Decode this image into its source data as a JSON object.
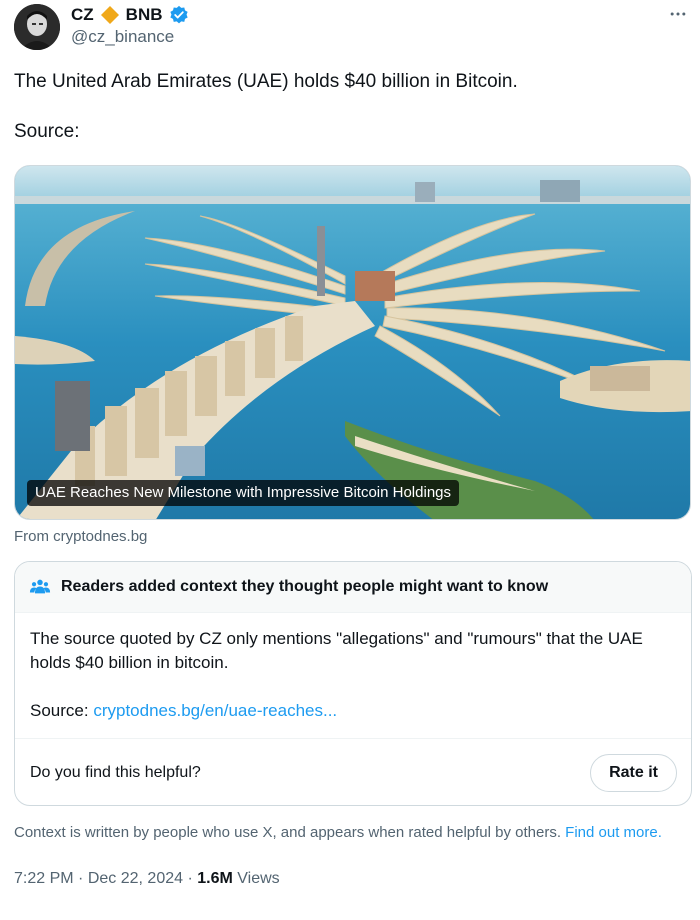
{
  "author": {
    "name": "CZ",
    "affiliation_label": "BNB",
    "handle": "@cz_binance",
    "icons": {
      "affiliation": "bnb-diamond-icon",
      "verified": "verified-badge-icon",
      "more": "more-horizontal-icon"
    },
    "colors": {
      "affiliation": "#f0a81a",
      "verified": "#1d9bf0"
    }
  },
  "tweet": {
    "text_line1": "The United Arab Emirates (UAE) holds $40 billion in Bitcoin.",
    "text_line2": "Source:"
  },
  "card": {
    "caption": "UAE Reaches New Milestone with Impressive Bitcoin Holdings",
    "source": "From cryptodnes.bg"
  },
  "community_note": {
    "header": "Readers added context they thought people might want to know",
    "body": "The source quoted by CZ only mentions \"allegations\" and \"rumours\" that the UAE holds $40 billion in bitcoin.",
    "source_label": "Source:",
    "source_link": "cryptodnes.bg/en/uae-reaches...",
    "helpful_question": "Do you find this helpful?",
    "rate_button": "Rate it",
    "footer_text": "Context is written by people who use X, and appears when rated helpful by others.",
    "footer_link": "Find out more."
  },
  "meta": {
    "time": "7:22 PM",
    "date": "Dec 22, 2024",
    "views_count": "1.6M",
    "views_label": "Views",
    "separator": "·"
  }
}
